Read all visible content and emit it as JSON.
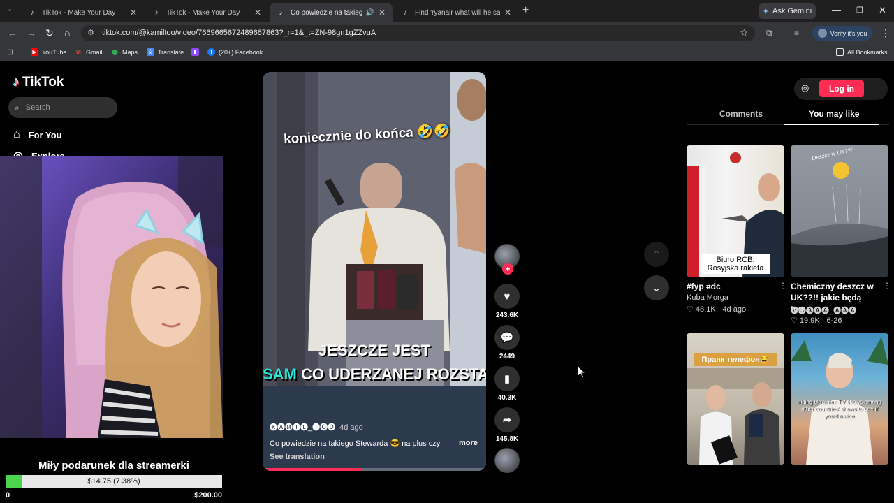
{
  "browser": {
    "tabs": [
      {
        "title": "TikTok - Make Your Day",
        "close": "✕"
      },
      {
        "title": "TikTok - Make Your Day",
        "close": "✕"
      },
      {
        "title": "Co powiedzie na takiego St",
        "close": "✕"
      },
      {
        "title": "Find 'ryanair what will he say to",
        "close": "✕"
      }
    ],
    "ask_gemini": "Ask Gemini",
    "url": "tiktok.com/@kamiltoo/video/7669665672489667863?_r=1&_t=ZN-98gn1gZZvuA",
    "verify": "Verify it's you",
    "bookmarks": [
      "YouTube",
      "Gmail",
      "Maps",
      "Translate",
      "(20+) Facebook"
    ],
    "all_bookmarks": "All Bookmarks"
  },
  "sidebar": {
    "logo": "TikTok",
    "search_placeholder": "Search",
    "nav_for_you": "For You",
    "nav_explore": "Explore"
  },
  "donation": {
    "title": "Miły podarunek dla streamerki",
    "label": "$14.75 (7.38%)",
    "min": "0",
    "max": "$200.00",
    "progress_pct": 7.38
  },
  "video": {
    "caption_top": "koniecznie do końca 🤣🤣",
    "caption_line1": "JESZCZE JEST",
    "caption_line2_hl": "SAM",
    "caption_line2": " CO UDERZANEJ ROZSTA",
    "author": "🅚🅐🅜🅘🅛_🅣🅞🅞",
    "ago": "4d ago",
    "description": "Co powiedzie na takiego Stewarda 😎 na plus czy",
    "more": "more",
    "see_translation": "See translation",
    "progress_pct": 44
  },
  "actions": {
    "likes": "243.6K",
    "comments": "2449",
    "saves": "40.3K",
    "shares": "145.8K"
  },
  "right_panel": {
    "login": "Log in",
    "tab_comments": "Comments",
    "tab_you_may_like": "You may like",
    "cards": [
      {
        "title": "#fyp #dc",
        "author": "Kuba Morga",
        "meta": "♡ 48.1K · 4d ago",
        "thumb_caption": "Biuro RCB: Rosyjska rakieta"
      },
      {
        "title": "Chemiczny deszcz w UK??!! jakie będą teg...",
        "author": "🅐🅐🅐🅐🅐_🅐🅐🅐",
        "meta": "♡ 19.9K · 6-26",
        "thumb_caption": "Deszcz w UK??!!"
      },
      {
        "title": "Пранк телефон",
        "thumb_caption": "Пранк телефон😂"
      },
      {
        "title": "",
        "thumb_caption": "hiding ukrainian TV shows among other countries' shows to see if you'd notice"
      }
    ]
  }
}
